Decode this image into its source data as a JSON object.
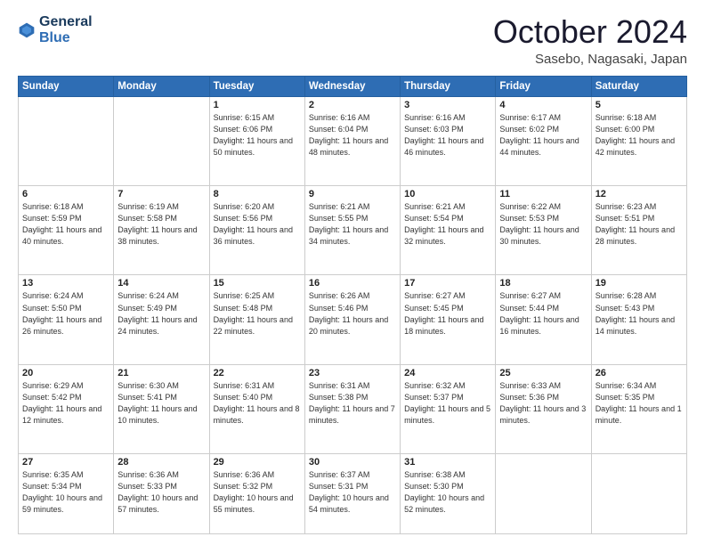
{
  "header": {
    "logo_line1": "General",
    "logo_line2": "Blue",
    "month_title": "October 2024",
    "location": "Sasebo, Nagasaki, Japan"
  },
  "weekdays": [
    "Sunday",
    "Monday",
    "Tuesday",
    "Wednesday",
    "Thursday",
    "Friday",
    "Saturday"
  ],
  "weeks": [
    [
      {
        "num": "",
        "info": ""
      },
      {
        "num": "",
        "info": ""
      },
      {
        "num": "1",
        "info": "Sunrise: 6:15 AM\nSunset: 6:06 PM\nDaylight: 11 hours and 50 minutes."
      },
      {
        "num": "2",
        "info": "Sunrise: 6:16 AM\nSunset: 6:04 PM\nDaylight: 11 hours and 48 minutes."
      },
      {
        "num": "3",
        "info": "Sunrise: 6:16 AM\nSunset: 6:03 PM\nDaylight: 11 hours and 46 minutes."
      },
      {
        "num": "4",
        "info": "Sunrise: 6:17 AM\nSunset: 6:02 PM\nDaylight: 11 hours and 44 minutes."
      },
      {
        "num": "5",
        "info": "Sunrise: 6:18 AM\nSunset: 6:00 PM\nDaylight: 11 hours and 42 minutes."
      }
    ],
    [
      {
        "num": "6",
        "info": "Sunrise: 6:18 AM\nSunset: 5:59 PM\nDaylight: 11 hours and 40 minutes."
      },
      {
        "num": "7",
        "info": "Sunrise: 6:19 AM\nSunset: 5:58 PM\nDaylight: 11 hours and 38 minutes."
      },
      {
        "num": "8",
        "info": "Sunrise: 6:20 AM\nSunset: 5:56 PM\nDaylight: 11 hours and 36 minutes."
      },
      {
        "num": "9",
        "info": "Sunrise: 6:21 AM\nSunset: 5:55 PM\nDaylight: 11 hours and 34 minutes."
      },
      {
        "num": "10",
        "info": "Sunrise: 6:21 AM\nSunset: 5:54 PM\nDaylight: 11 hours and 32 minutes."
      },
      {
        "num": "11",
        "info": "Sunrise: 6:22 AM\nSunset: 5:53 PM\nDaylight: 11 hours and 30 minutes."
      },
      {
        "num": "12",
        "info": "Sunrise: 6:23 AM\nSunset: 5:51 PM\nDaylight: 11 hours and 28 minutes."
      }
    ],
    [
      {
        "num": "13",
        "info": "Sunrise: 6:24 AM\nSunset: 5:50 PM\nDaylight: 11 hours and 26 minutes."
      },
      {
        "num": "14",
        "info": "Sunrise: 6:24 AM\nSunset: 5:49 PM\nDaylight: 11 hours and 24 minutes."
      },
      {
        "num": "15",
        "info": "Sunrise: 6:25 AM\nSunset: 5:48 PM\nDaylight: 11 hours and 22 minutes."
      },
      {
        "num": "16",
        "info": "Sunrise: 6:26 AM\nSunset: 5:46 PM\nDaylight: 11 hours and 20 minutes."
      },
      {
        "num": "17",
        "info": "Sunrise: 6:27 AM\nSunset: 5:45 PM\nDaylight: 11 hours and 18 minutes."
      },
      {
        "num": "18",
        "info": "Sunrise: 6:27 AM\nSunset: 5:44 PM\nDaylight: 11 hours and 16 minutes."
      },
      {
        "num": "19",
        "info": "Sunrise: 6:28 AM\nSunset: 5:43 PM\nDaylight: 11 hours and 14 minutes."
      }
    ],
    [
      {
        "num": "20",
        "info": "Sunrise: 6:29 AM\nSunset: 5:42 PM\nDaylight: 11 hours and 12 minutes."
      },
      {
        "num": "21",
        "info": "Sunrise: 6:30 AM\nSunset: 5:41 PM\nDaylight: 11 hours and 10 minutes."
      },
      {
        "num": "22",
        "info": "Sunrise: 6:31 AM\nSunset: 5:40 PM\nDaylight: 11 hours and 8 minutes."
      },
      {
        "num": "23",
        "info": "Sunrise: 6:31 AM\nSunset: 5:38 PM\nDaylight: 11 hours and 7 minutes."
      },
      {
        "num": "24",
        "info": "Sunrise: 6:32 AM\nSunset: 5:37 PM\nDaylight: 11 hours and 5 minutes."
      },
      {
        "num": "25",
        "info": "Sunrise: 6:33 AM\nSunset: 5:36 PM\nDaylight: 11 hours and 3 minutes."
      },
      {
        "num": "26",
        "info": "Sunrise: 6:34 AM\nSunset: 5:35 PM\nDaylight: 11 hours and 1 minute."
      }
    ],
    [
      {
        "num": "27",
        "info": "Sunrise: 6:35 AM\nSunset: 5:34 PM\nDaylight: 10 hours and 59 minutes."
      },
      {
        "num": "28",
        "info": "Sunrise: 6:36 AM\nSunset: 5:33 PM\nDaylight: 10 hours and 57 minutes."
      },
      {
        "num": "29",
        "info": "Sunrise: 6:36 AM\nSunset: 5:32 PM\nDaylight: 10 hours and 55 minutes."
      },
      {
        "num": "30",
        "info": "Sunrise: 6:37 AM\nSunset: 5:31 PM\nDaylight: 10 hours and 54 minutes."
      },
      {
        "num": "31",
        "info": "Sunrise: 6:38 AM\nSunset: 5:30 PM\nDaylight: 10 hours and 52 minutes."
      },
      {
        "num": "",
        "info": ""
      },
      {
        "num": "",
        "info": ""
      }
    ]
  ]
}
